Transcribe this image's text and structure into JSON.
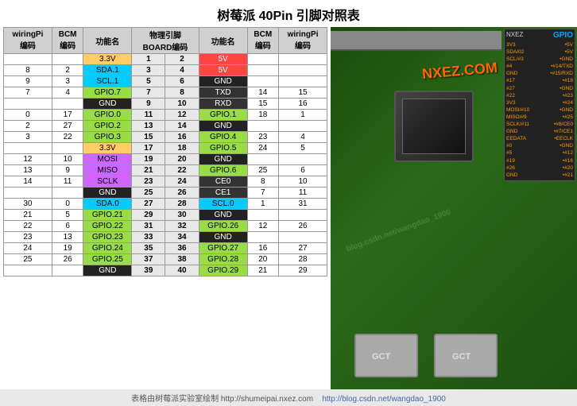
{
  "title": "树莓派 40Pin 引脚对照表",
  "headers": {
    "wiringPi_code": "wiringPi\n编码",
    "bcm_code": "BCM\n编码",
    "func_name": "功能名",
    "board_code": "物理引脚\nBOARD编码",
    "func_name2": "功能名",
    "bcm_code2": "BCM\n编码",
    "wiringPi_code2": "wiringPi\n编码"
  },
  "rows": [
    {
      "wpi1": "",
      "bcm1": "",
      "func1": "3.3V",
      "pin1": 1,
      "pin2": 2,
      "func2": "5V",
      "bcm2": "",
      "wpi2": "",
      "color1": "3v3",
      "color2": "5v"
    },
    {
      "wpi1": "8",
      "bcm1": "2",
      "func1": "SDA.1",
      "pin1": 3,
      "pin2": 4,
      "func2": "5V",
      "bcm2": "",
      "wpi2": "",
      "color1": "sda1",
      "color2": "5v"
    },
    {
      "wpi1": "9",
      "bcm1": "3",
      "func1": "SCL.1",
      "pin1": 5,
      "pin2": 6,
      "func2": "GND",
      "bcm2": "",
      "wpi2": "",
      "color1": "scl1",
      "color2": "gnd"
    },
    {
      "wpi1": "7",
      "bcm1": "4",
      "func1": "GPIO.7",
      "pin1": 7,
      "pin2": 8,
      "func2": "TXD",
      "bcm2": "14",
      "wpi2": "15",
      "color1": "gpio",
      "color2": "txd"
    },
    {
      "wpi1": "",
      "bcm1": "",
      "func1": "GND",
      "pin1": 9,
      "pin2": 10,
      "func2": "RXD",
      "bcm2": "15",
      "wpi2": "16",
      "color1": "gnd",
      "color2": "rxd"
    },
    {
      "wpi1": "0",
      "bcm1": "17",
      "func1": "GPIO.0",
      "pin1": 11,
      "pin2": 12,
      "func2": "GPIO.1",
      "bcm2": "18",
      "wpi2": "1",
      "color1": "gpio",
      "color2": "gpio"
    },
    {
      "wpi1": "2",
      "bcm1": "27",
      "func1": "GPIO.2",
      "pin1": 13,
      "pin2": 14,
      "func2": "GND",
      "bcm2": "",
      "wpi2": "",
      "color1": "gpio",
      "color2": "gnd"
    },
    {
      "wpi1": "3",
      "bcm1": "22",
      "func1": "GPIO.3",
      "pin1": 15,
      "pin2": 16,
      "func2": "GPIO.4",
      "bcm2": "23",
      "wpi2": "4",
      "color1": "gpio",
      "color2": "gpio"
    },
    {
      "wpi1": "",
      "bcm1": "",
      "func1": "3.3V",
      "pin1": 17,
      "pin2": 18,
      "func2": "GPIO.5",
      "bcm2": "24",
      "wpi2": "5",
      "color1": "3v3",
      "color2": "gpio"
    },
    {
      "wpi1": "12",
      "bcm1": "10",
      "func1": "MOSI",
      "pin1": 19,
      "pin2": 20,
      "func2": "GND",
      "bcm2": "",
      "wpi2": "",
      "color1": "mosi",
      "color2": "gnd"
    },
    {
      "wpi1": "13",
      "bcm1": "9",
      "func1": "MISO",
      "pin1": 21,
      "pin2": 22,
      "func2": "GPIO.6",
      "bcm2": "25",
      "wpi2": "6",
      "color1": "miso",
      "color2": "gpio6"
    },
    {
      "wpi1": "14",
      "bcm1": "11",
      "func1": "SCLK",
      "pin1": 23,
      "pin2": 24,
      "func2": "CE0",
      "bcm2": "8",
      "wpi2": "10",
      "color1": "sclk",
      "color2": "ce0"
    },
    {
      "wpi1": "",
      "bcm1": "",
      "func1": "GND",
      "pin1": 25,
      "pin2": 26,
      "func2": "CE1",
      "bcm2": "7",
      "wpi2": "11",
      "color1": "gnd",
      "color2": "ce1"
    },
    {
      "wpi1": "30",
      "bcm1": "0",
      "func1": "SDA.0",
      "pin1": 27,
      "pin2": 28,
      "func2": "SCL.0",
      "bcm2": "1",
      "wpi2": "31",
      "color1": "sda0",
      "color2": "scl0"
    },
    {
      "wpi1": "21",
      "bcm1": "5",
      "func1": "GPIO.21",
      "pin1": 29,
      "pin2": 30,
      "func2": "GND",
      "bcm2": "",
      "wpi2": "",
      "color1": "gpio",
      "color2": "gnd"
    },
    {
      "wpi1": "22",
      "bcm1": "6",
      "func1": "GPIO.22",
      "pin1": 31,
      "pin2": 32,
      "func2": "GPIO.26",
      "bcm2": "12",
      "wpi2": "26",
      "color1": "gpio",
      "color2": "gpio"
    },
    {
      "wpi1": "23",
      "bcm1": "13",
      "func1": "GPIO.23",
      "pin1": 33,
      "pin2": 34,
      "func2": "GND",
      "bcm2": "",
      "wpi2": "",
      "color1": "gpio",
      "color2": "gnd"
    },
    {
      "wpi1": "24",
      "bcm1": "19",
      "func1": "GPIO.24",
      "pin1": 35,
      "pin2": 36,
      "func2": "GPIO.27",
      "bcm2": "16",
      "wpi2": "27",
      "color1": "gpio",
      "color2": "gpio"
    },
    {
      "wpi1": "25",
      "bcm1": "26",
      "func1": "GPIO.25",
      "pin1": 37,
      "pin2": 38,
      "func2": "GPIO.28",
      "bcm2": "20",
      "wpi2": "28",
      "color1": "gpio",
      "color2": "gpio"
    },
    {
      "wpi1": "",
      "bcm1": "",
      "func1": "GND",
      "pin1": 39,
      "pin2": 40,
      "func2": "GPIO.29",
      "bcm2": "21",
      "wpi2": "29",
      "color1": "gnd",
      "color2": "gpio"
    }
  ],
  "footer": "表格由树莓派实验室绘制 http://shumeipai.nxez.com",
  "footer2": "http://blog.csdn.net/wangdao_1900",
  "nxez_com": "NXEZ.COM",
  "watermark": "blog.csdn.net/wangdao_1900",
  "gpio_strip": {
    "nxez": "NXEZ",
    "gpio": "GPIO",
    "pins": [
      {
        "left": "3V3",
        "right": "•5V"
      },
      {
        "left": "SDA/02",
        "right": "•5V"
      },
      {
        "left": "SCL/#3",
        "right": "•GND"
      },
      {
        "left": "#4",
        "right": "•#14/TXD"
      },
      {
        "left": "GND",
        "right": "•#15/RXD"
      },
      {
        "left": "#17",
        "right": "•#18"
      },
      {
        "left": "#27",
        "right": "•GND"
      },
      {
        "left": "#22",
        "right": "•#23"
      },
      {
        "left": "3V3",
        "right": "•#24"
      },
      {
        "left": "MOSI/#10",
        "right": "•GND"
      },
      {
        "left": "MISO/#9",
        "right": "•#25"
      },
      {
        "left": "SCLK/#11",
        "right": "•#8/CE0"
      },
      {
        "left": "GND",
        "right": "•#7/CE1"
      },
      {
        "left": "EEDATA",
        "right": "•EECLK"
      },
      {
        "left": "#0",
        "right": "•GND"
      },
      {
        "left": "#5",
        "right": "•#12"
      },
      {
        "left": "#19",
        "right": "•#16"
      },
      {
        "left": "#26",
        "right": "•#20"
      },
      {
        "left": "GND",
        "right": "•#21"
      }
    ]
  }
}
